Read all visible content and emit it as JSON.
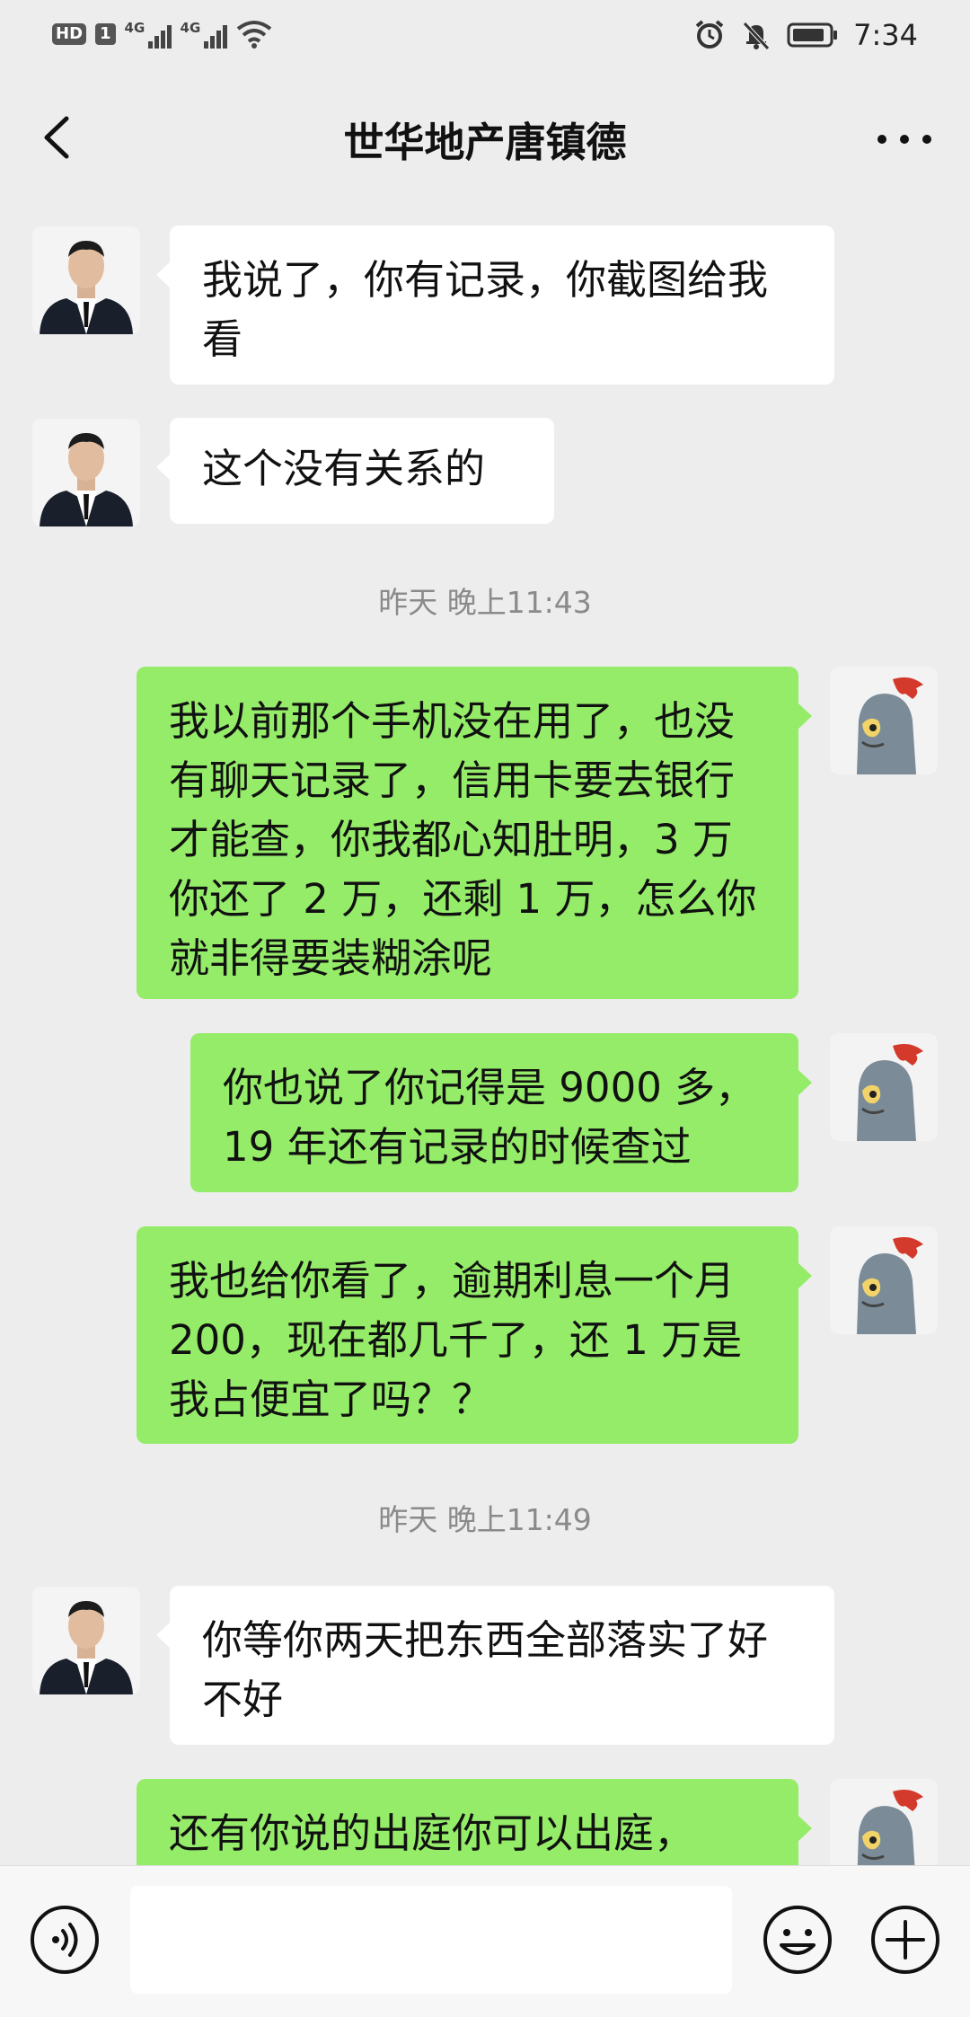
{
  "status_bar": {
    "hd": "HD",
    "sim": "1",
    "net1": "4G",
    "net2": "4G",
    "time": "7:34"
  },
  "header": {
    "title": "世华地产唐镇德"
  },
  "messages": [
    {
      "from": "other",
      "text": "我说了，你有记录，你截图给我看"
    },
    {
      "from": "other",
      "text": "这个没有关系的"
    },
    {
      "type": "time",
      "text": "昨天 晚上11:43"
    },
    {
      "from": "me",
      "text": "我以前那个手机没在用了，也没有聊天记录了，信用卡要去银行才能查，你我都心知肚明，3 万你还了 2 万，还剩 1 万，怎么你就非得要装糊涂呢"
    },
    {
      "from": "me",
      "text": "你也说了你记得是 9000 多，19 年还有记录的时候查过"
    },
    {
      "from": "me",
      "text": "我也给你看了，逾期利息一个月 200，现在都几千了，还 1 万是我占便宜了吗？？"
    },
    {
      "type": "time",
      "text": "昨天 晚上11:49"
    },
    {
      "from": "other",
      "text": "你等你两天把东西全部落实了好不好"
    },
    {
      "from": "me",
      "text": "还有你说的出庭你可以出庭，"
    }
  ],
  "colors": {
    "background": "#ededed",
    "incoming_bubble": "#ffffff",
    "outgoing_bubble": "#95ec69"
  },
  "icons": {
    "back": "chevron-left-icon",
    "more": "more-dots-icon",
    "voice": "voice-input-icon",
    "emoji": "emoji-icon",
    "plus": "plus-icon"
  }
}
